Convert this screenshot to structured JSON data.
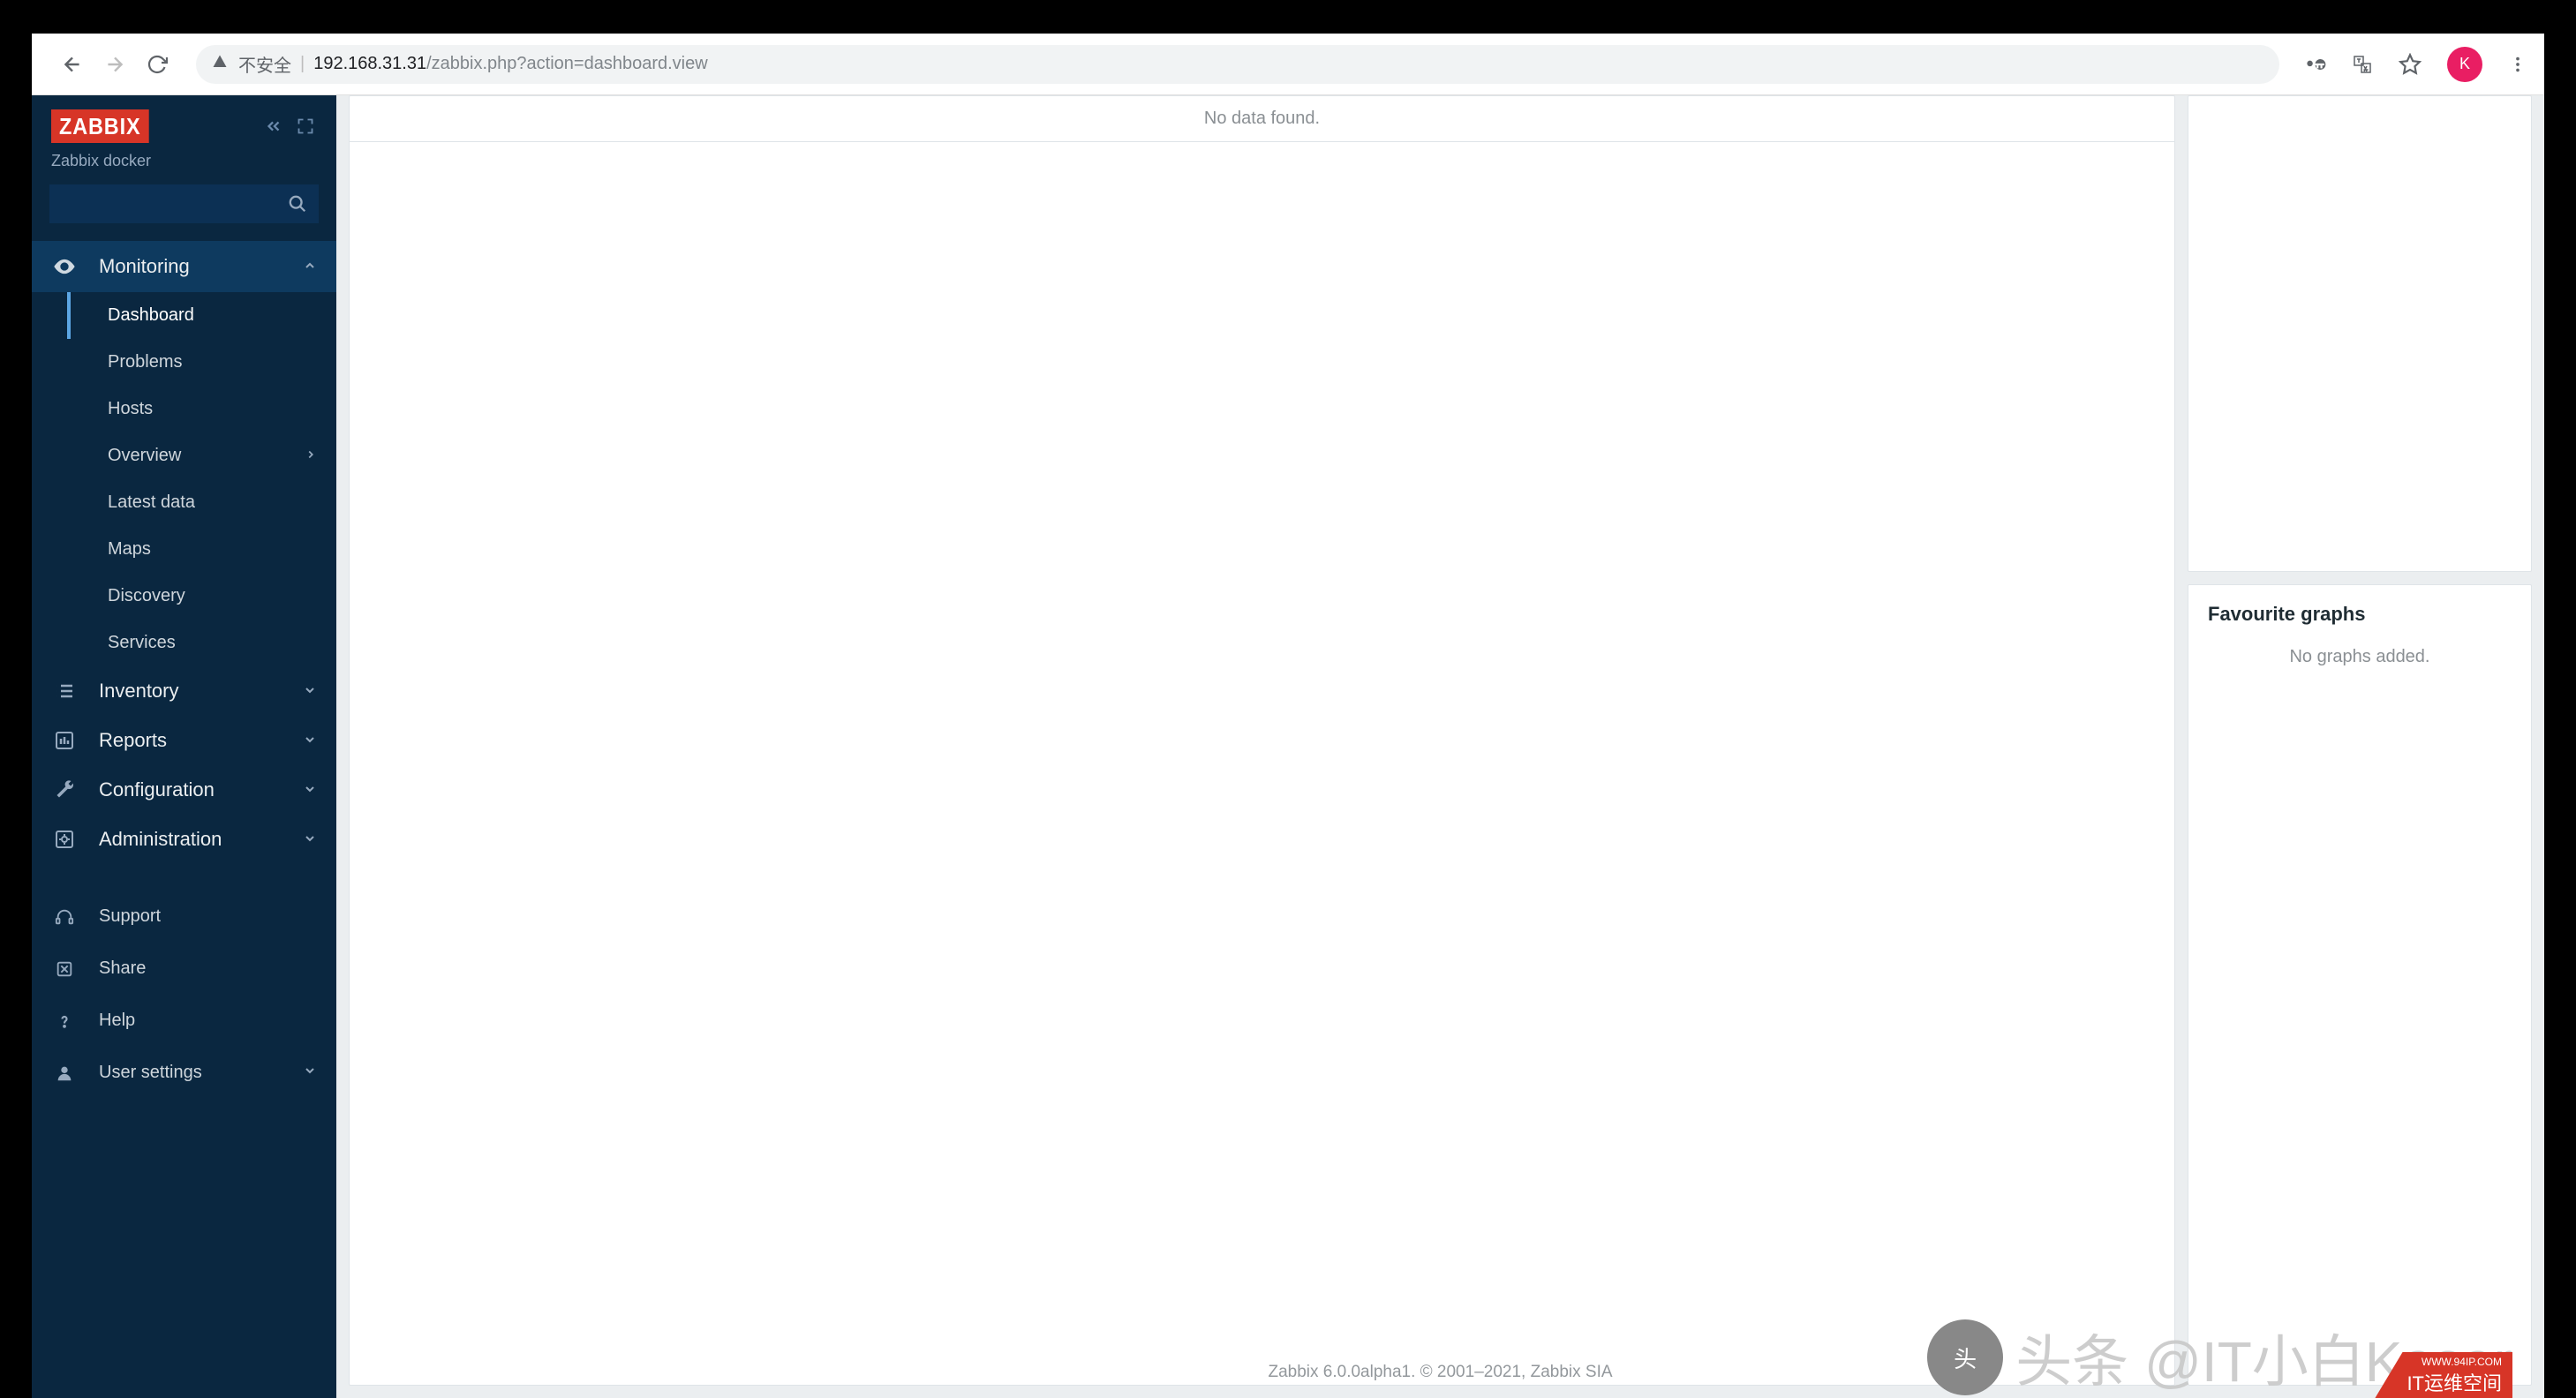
{
  "browser": {
    "security_label": "不安全",
    "url_host": "192.168.31.31",
    "url_path": "/zabbix.php?action=dashboard.view",
    "avatar_letter": "K"
  },
  "sidebar": {
    "logo": "ZABBIX",
    "subtitle": "Zabbix docker",
    "search_placeholder": "",
    "monitoring": {
      "label": "Monitoring",
      "items": [
        {
          "label": "Dashboard"
        },
        {
          "label": "Problems"
        },
        {
          "label": "Hosts"
        },
        {
          "label": "Overview"
        },
        {
          "label": "Latest data"
        },
        {
          "label": "Maps"
        },
        {
          "label": "Discovery"
        },
        {
          "label": "Services"
        }
      ]
    },
    "inventory_label": "Inventory",
    "reports_label": "Reports",
    "configuration_label": "Configuration",
    "administration_label": "Administration",
    "support_label": "Support",
    "share_label": "Share",
    "help_label": "Help",
    "user_settings_label": "User settings"
  },
  "main": {
    "no_data": "No data found.",
    "fav_title": "Favourite graphs",
    "fav_empty": "No graphs added."
  },
  "footer": "Zabbix 6.0.0alpha1. © 2001–2021, Zabbix SIA",
  "watermark": {
    "handle": "头条 @IT小白Kasar",
    "tag_small": "WWW.94IP.COM",
    "tag": "IT运维空间"
  }
}
